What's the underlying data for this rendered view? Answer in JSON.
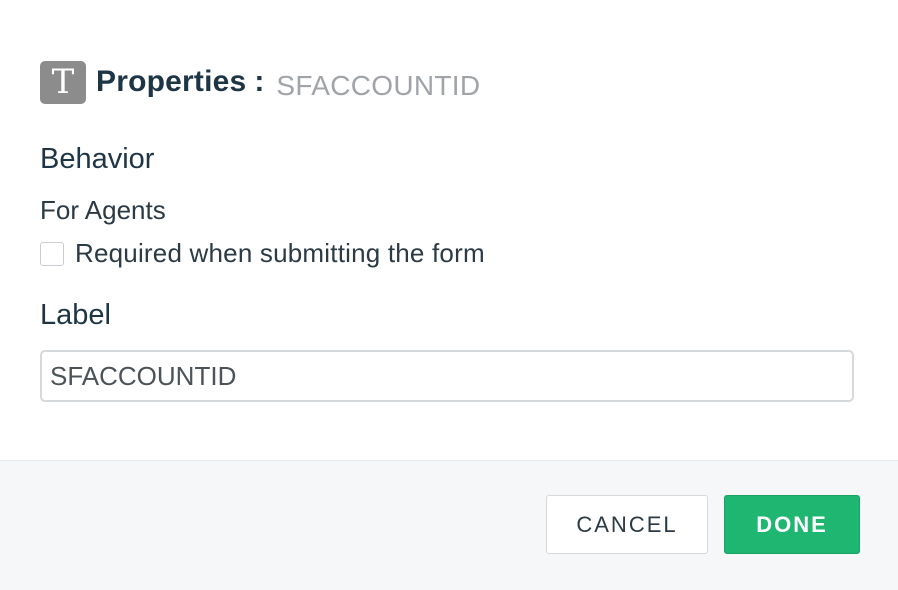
{
  "header": {
    "icon": "text-field-icon",
    "icon_glyph": "T",
    "title": "Properties",
    "separator": ":",
    "field_name": "SFACCOUNTID"
  },
  "behavior": {
    "section_title": "Behavior",
    "audience_label": "For Agents",
    "required_checkbox": {
      "label": "Required when submitting the form",
      "checked": false
    }
  },
  "label_section": {
    "section_title": "Label",
    "input_value": "SFACCOUNTID"
  },
  "footer": {
    "cancel_label": "CANCEL",
    "done_label": "DONE"
  },
  "colors": {
    "primary": "#1fb672",
    "heading": "#1d3545",
    "icon_bg": "#8c8c8c"
  }
}
